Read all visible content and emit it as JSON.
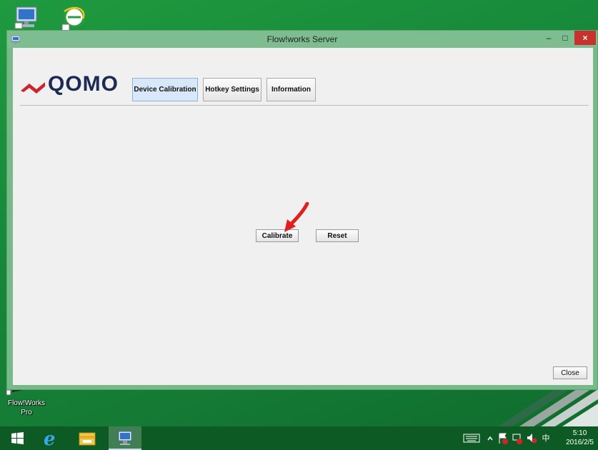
{
  "desktop": {
    "icons": {
      "flowworks_label": "Flow!Works",
      "flowworks_sublabel": "Pro"
    }
  },
  "window": {
    "title": "Flow!works Server",
    "controls": {
      "minimize": "–",
      "maximize": "□",
      "close": "×"
    }
  },
  "header": {
    "logo_text": "QOMO",
    "tabs": [
      {
        "label": "Device Calibration",
        "selected": true
      },
      {
        "label": "Hotkey Settings",
        "selected": false
      },
      {
        "label": "Information",
        "selected": false
      }
    ]
  },
  "main": {
    "calibrate_label": "Calibrate",
    "reset_label": "Reset",
    "close_label": "Close"
  },
  "taskbar": {
    "clock_time": "5:10",
    "clock_date": "2016/2/5",
    "ime_indicator": "中"
  },
  "colors": {
    "desktop_green": "#1a8f3b",
    "window_frame": "#78b98a",
    "close_red": "#c7322e",
    "taskbar": "#0e5a24",
    "selected_tab": "#d9e8f8",
    "logo_red": "#d0242c",
    "logo_navy": "#1e2a56",
    "annotation_arrow": "#e21f1f"
  }
}
